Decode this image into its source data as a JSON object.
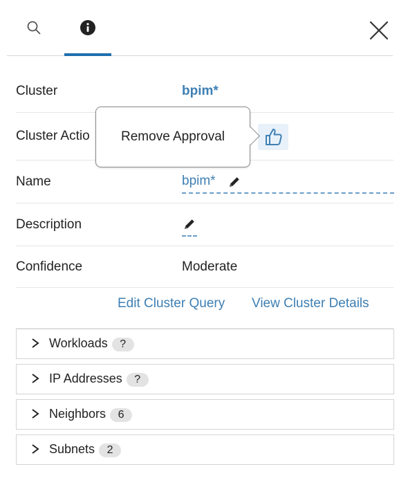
{
  "tabs": {
    "search": "search",
    "info": "info"
  },
  "fields": {
    "cluster": {
      "label": "Cluster",
      "value": "bpim*"
    },
    "cluster_action": {
      "label": "Cluster Actio"
    },
    "name": {
      "label": "Name",
      "value": "bpim*"
    },
    "description": {
      "label": "Description",
      "value": ""
    },
    "confidence": {
      "label": "Confidence",
      "value": "Moderate"
    }
  },
  "tooltip": {
    "text": "Remove Approval"
  },
  "links": {
    "edit_query": "Edit Cluster Query",
    "view_details": "View Cluster Details"
  },
  "sections": [
    {
      "title": "Workloads",
      "badge": "?"
    },
    {
      "title": "IP Addresses",
      "badge": "?"
    },
    {
      "title": "Neighbors",
      "badge": "6"
    },
    {
      "title": "Subnets",
      "badge": "2"
    }
  ],
  "colors": {
    "accent": "#3e7fb3",
    "tab_underline": "#1f6fad"
  }
}
